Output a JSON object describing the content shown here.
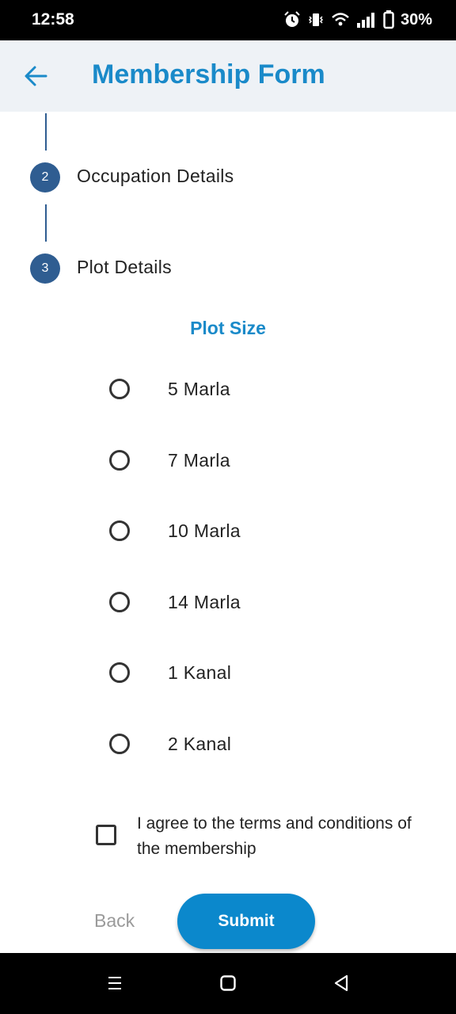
{
  "status_bar": {
    "time": "12:58",
    "battery": "30%",
    "icons": [
      "alarm-icon",
      "vibrate-icon",
      "wifi-icon",
      "signal-icon",
      "battery-icon"
    ]
  },
  "app_bar": {
    "title": "Membership Form",
    "back_icon": "arrow-left-icon",
    "accent_color": "#1a8ac9"
  },
  "stepper": {
    "color": "#2f5d91",
    "steps": [
      {
        "number": "2",
        "label": "Occupation Details"
      },
      {
        "number": "3",
        "label": "Plot Details"
      }
    ]
  },
  "plot_size": {
    "title": "Plot Size",
    "options": [
      "5 Marla",
      "7 Marla",
      "10 Marla",
      "14 Marla",
      "1 Kanal",
      "2 Kanal"
    ],
    "selected": null
  },
  "terms": {
    "checked": false,
    "text": "I agree to the terms and conditions of the membership"
  },
  "actions": {
    "back_label": "Back",
    "submit_label": "Submit",
    "submit_color": "#0b88cc"
  },
  "nav_bar": {
    "icons": [
      "recents-icon",
      "home-icon",
      "back-triangle-icon"
    ]
  }
}
